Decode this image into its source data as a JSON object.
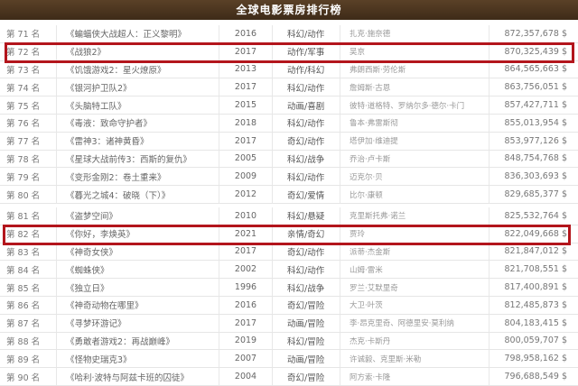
{
  "header": {
    "title": "全球电影票房排行榜"
  },
  "colors": {
    "highlight": "#b3151c",
    "header_bg": "#4a3420"
  },
  "rows_a": [
    {
      "rank": "第 71 名",
      "title": "《蝙蝠侠大战超人：正义黎明》",
      "year": "2016",
      "genre": "科幻/动作",
      "director": "扎克·施奈德",
      "gross": "872,357,678 $"
    },
    {
      "rank": "第 72 名",
      "title": "《战狼2》",
      "year": "2017",
      "genre": "动作/军事",
      "director": "吴京",
      "gross": "870,325,439 $"
    },
    {
      "rank": "第 73 名",
      "title": "《饥饿游戏2：星火燎原》",
      "year": "2013",
      "genre": "动作/科幻",
      "director": "弗朗西斯·劳伦斯",
      "gross": "864,565,663 $"
    },
    {
      "rank": "第 74 名",
      "title": "《银河护卫队2》",
      "year": "2017",
      "genre": "科幻/动作",
      "director": "詹姆斯·古恩",
      "gross": "863,756,051 $"
    },
    {
      "rank": "第 75 名",
      "title": "《头脑特工队》",
      "year": "2015",
      "genre": "动画/喜剧",
      "director": "彼特·道格特、罗纳尔多·德尔·卡门",
      "gross": "857,427,711 $"
    },
    {
      "rank": "第 76 名",
      "title": "《毒液：致命守护者》",
      "year": "2018",
      "genre": "科幻/动作",
      "director": "鲁本·弗雷斯彻",
      "gross": "855,013,954 $"
    },
    {
      "rank": "第 77 名",
      "title": "《雷神3：诸神黄昏》",
      "year": "2017",
      "genre": "奇幻/动作",
      "director": "塔伊加·维迪提",
      "gross": "853,977,126 $"
    },
    {
      "rank": "第 78 名",
      "title": "《星球大战前传3：西斯的复仇》",
      "year": "2005",
      "genre": "科幻/战争",
      "director": "乔治·卢卡斯",
      "gross": "848,754,768 $"
    },
    {
      "rank": "第 79 名",
      "title": "《变形金刚2：卷土重来》",
      "year": "2009",
      "genre": "科幻/动作",
      "director": "迈克尔·贝",
      "gross": "836,303,693 $"
    },
    {
      "rank": "第 80 名",
      "title": "《暮光之城4：破晓（下）》",
      "year": "2012",
      "genre": "奇幻/爱情",
      "director": "比尔·康顿",
      "gross": "829,685,377 $"
    }
  ],
  "rows_b": [
    {
      "rank": "第 81 名",
      "title": "《盗梦空间》",
      "year": "2010",
      "genre": "科幻/悬疑",
      "director": "克里斯托弗·诺兰",
      "gross": "825,532,764 $"
    },
    {
      "rank": "第 82 名",
      "title": "《你好，李焕英》",
      "year": "2021",
      "genre": "亲情/奇幻",
      "director": "贾玲",
      "gross": "822,049,668 $"
    },
    {
      "rank": "第 83 名",
      "title": "《神奇女侠》",
      "year": "2017",
      "genre": "奇幻/动作",
      "director": "派蒂·杰金斯",
      "gross": "821,847,012 $"
    },
    {
      "rank": "第 84 名",
      "title": "《蜘蛛侠》",
      "year": "2002",
      "genre": "科幻/动作",
      "director": "山姆·雷米",
      "gross": "821,708,551 $"
    },
    {
      "rank": "第 85 名",
      "title": "《独立日》",
      "year": "1996",
      "genre": "科幻/战争",
      "director": "罗兰·艾默里奇",
      "gross": "817,400,891 $"
    },
    {
      "rank": "第 86 名",
      "title": "《神奇动物在哪里》",
      "year": "2016",
      "genre": "奇幻/冒险",
      "director": "大卫·叶茨",
      "gross": "812,485,873 $"
    },
    {
      "rank": "第 87 名",
      "title": "《寻梦环游记》",
      "year": "2017",
      "genre": "动画/冒险",
      "director": "李·昂克里奇、阿德里安·莫利纳",
      "gross": "804,183,415 $"
    },
    {
      "rank": "第 88 名",
      "title": "《勇敢者游戏2：再战巅峰》",
      "year": "2019",
      "genre": "科幻/冒险",
      "director": "杰克·卡斯丹",
      "gross": "800,059,707 $"
    },
    {
      "rank": "第 89 名",
      "title": "《怪物史瑞克3》",
      "year": "2007",
      "genre": "动画/冒险",
      "director": "许诚毅、克里斯·米勒",
      "gross": "798,958,162 $"
    },
    {
      "rank": "第 90 名",
      "title": "《哈利·波特与阿兹卡班的囚徒》",
      "year": "2004",
      "genre": "奇幻/冒险",
      "director": "阿方索·卡隆",
      "gross": "796,688,549 $"
    }
  ]
}
